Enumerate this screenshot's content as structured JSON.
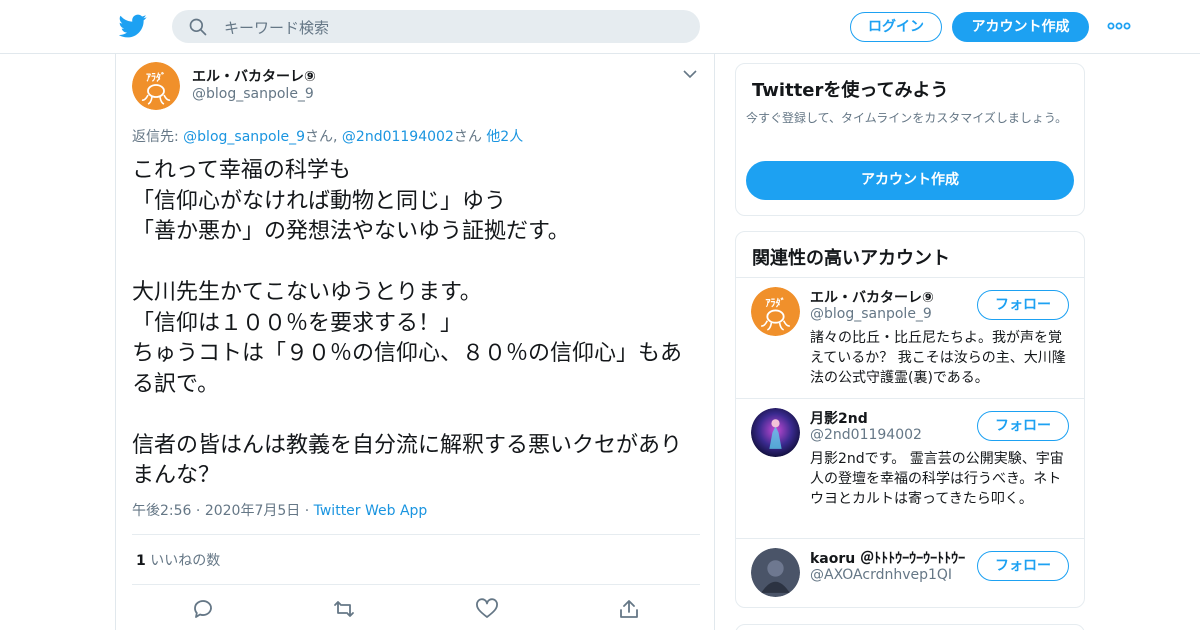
{
  "header": {
    "search_placeholder": "キーワード検索",
    "login_label": "ログイン",
    "signup_label": "アカウント作成",
    "brand_color": "#1da1f2"
  },
  "tweet": {
    "author_name": "エル・バカターレ⑨",
    "author_handle": "@blog_sanpole_9",
    "avatar_text": "ｱﾗﾀﾞ",
    "reply_prefix": "返信先: ",
    "reply_to_1": "@blog_sanpole_9",
    "reply_sep_1": "さん, ",
    "reply_to_2": "@2nd01194002",
    "reply_sep_2": "さん ",
    "reply_others": "他2人",
    "text": "これって幸福の科学も\n「信仰心がなければ動物と同じ」ゆう\n「善か悪か」の発想法やないゆう証拠だす。\n\n大川先生かてこないゆうとります。\n「信仰は１００％を要求する！」\nちゅうコトは「９０％の信仰心、８０％の信仰心」もある訳で。\n\n信者の皆はんは教義を自分流に解釈する悪いクセがありまんな？",
    "time": "午後2:56",
    "date": "2020年7月5日",
    "source": "Twitter Web App",
    "likes_count": "1",
    "likes_label": "いいねの数"
  },
  "signup_card": {
    "title": "Twitterを使ってみよう",
    "description": "今すぐ登録して、タイムラインをカスタマイズしましょう。",
    "button": "アカウント作成"
  },
  "related": {
    "title": "関連性の高いアカウント",
    "follow_label": "フォロー",
    "accounts": [
      {
        "name": "エル・バカターレ⑨",
        "handle": "@blog_sanpole_9",
        "bio": "諸々の比丘・比丘尼たちよ。我が声を覚えているか？ 我こそは汝らの主、大川隆法の公式守護霊(裏)である。"
      },
      {
        "name": "月影2nd",
        "handle": "@2nd01194002",
        "bio": "月影2ndです。 霊言芸の公開実験、宇宙人の登壇を幸福の科学は行うべき。ネトウヨとカルトは寄ってきたら叩く。"
      },
      {
        "name": "kaoru ＠ﾄﾄﾄｳｰｳｰｳｰﾄﾄｳｰ",
        "handle": "@AXOAcrdnhvep1QI",
        "bio": ""
      }
    ]
  }
}
